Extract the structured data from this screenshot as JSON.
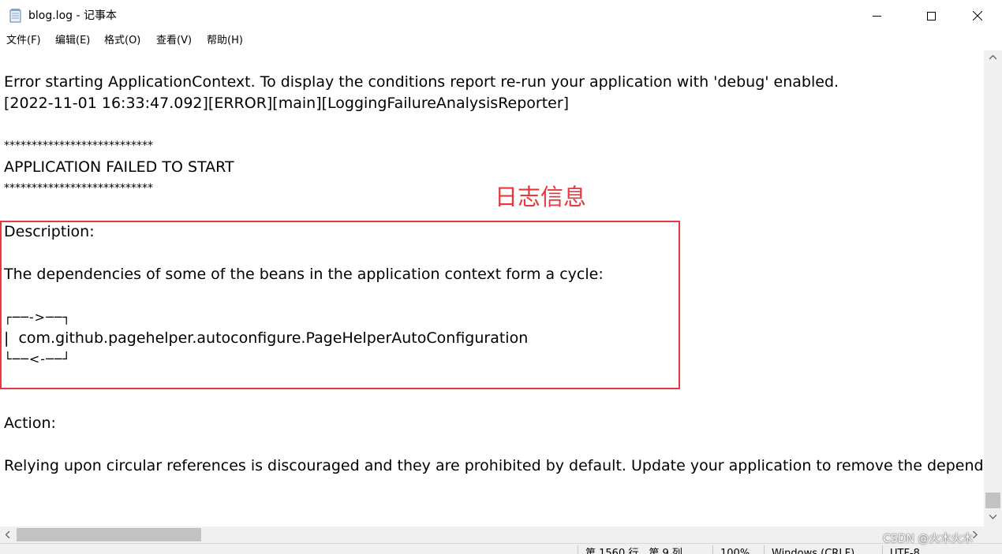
{
  "window": {
    "title": "blog.log - 记事本",
    "buttons": {
      "minimize": "—",
      "maximize": "☐",
      "close": "✕"
    }
  },
  "menu": {
    "items": [
      "文件(F)",
      "编辑(E)",
      "格式(O)",
      "查看(V)",
      "帮助(H)"
    ]
  },
  "editor": {
    "lines": [
      "Error starting ApplicationContext. To display the conditions report re-run your application with 'debug' enabled.",
      "[2022-11-01 16:33:47.092][ERROR][main][LoggingFailureAnalysisReporter]",
      "",
      "***************************",
      "APPLICATION FAILED TO START",
      "***************************",
      "",
      "Description:",
      "",
      "The dependencies of some of the beans in the application context form a cycle:",
      "",
      "┌──->──┐",
      "|  com.github.pagehelper.autoconfigure.PageHelperAutoConfiguration",
      "└──<-──┘",
      "",
      "",
      "Action:",
      "",
      "Relying upon circular references is discouraged and they are prohibited by default. Update your application to remove the dependency cycle between beans."
    ]
  },
  "status": {
    "position": "第 1560 行，第 9 列",
    "zoom": "100%",
    "line_ending": "Windows (CRLF)",
    "encoding": "UTF-8"
  },
  "annotation": {
    "label": "日志信息",
    "color": "#e8383d"
  },
  "watermark": "CSDN @火木火木"
}
